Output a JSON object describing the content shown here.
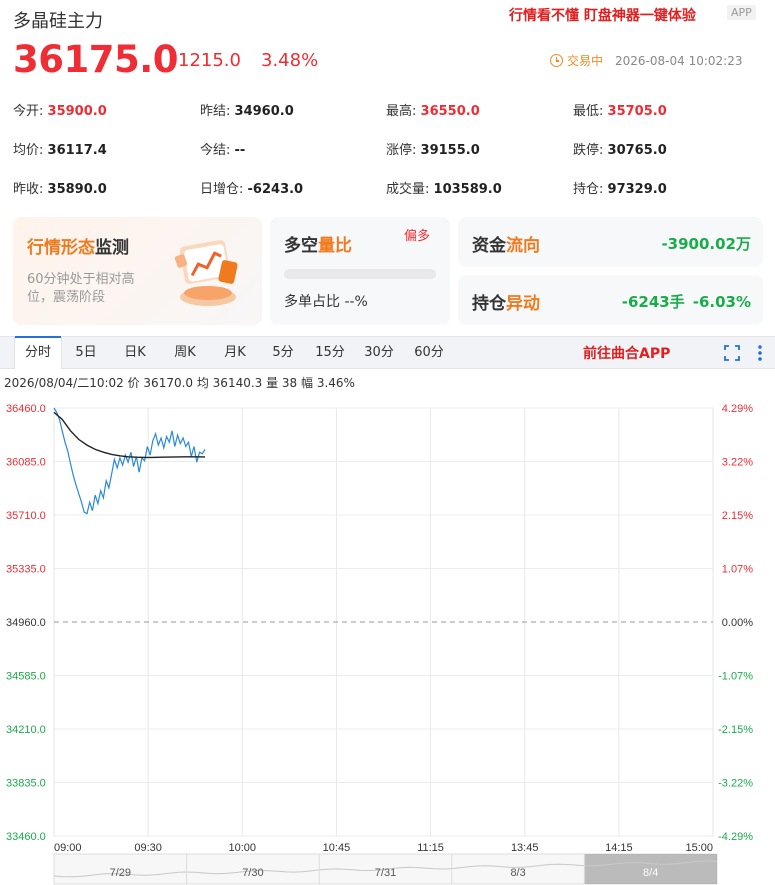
{
  "header": {
    "title": "多晶硅主力",
    "promo": "行情看不懂 盯盘神器一键体验",
    "app_badge": "APP",
    "price": "36175.0",
    "change": "1215.0",
    "change_pct": "3.48%",
    "status": "交易中",
    "datetime": "2026-08-04 10:02:23",
    "accent_up": "#ee2d34",
    "accent_down": "#1aab4b"
  },
  "stats": {
    "row1": [
      {
        "label": "今开:",
        "value": "35900.0",
        "color": "red"
      },
      {
        "label": "昨结:",
        "value": "34960.0",
        "color": "black"
      },
      {
        "label": "最高:",
        "value": "36550.0",
        "color": "red"
      },
      {
        "label": "最低:",
        "value": "35705.0",
        "color": "red"
      }
    ],
    "row2": [
      {
        "label": "均价:",
        "value": "36117.4",
        "color": "black"
      },
      {
        "label": "今结:",
        "value": "--",
        "color": "black"
      },
      {
        "label": "涨停:",
        "value": "39155.0",
        "color": "black"
      },
      {
        "label": "跌停:",
        "value": "30765.0",
        "color": "black"
      }
    ],
    "row3": [
      {
        "label": "昨收:",
        "value": "35890.0",
        "color": "black"
      },
      {
        "label": "日增仓:",
        "value": "-6243.0",
        "color": "black"
      },
      {
        "label": "成交量:",
        "value": "103589.0",
        "color": "black"
      },
      {
        "label": "持仓:",
        "value": "97329.0",
        "color": "black"
      }
    ]
  },
  "cards": {
    "pattern": {
      "title_a": "行情形态",
      "title_b": "监测",
      "desc": "60分钟处于相对高位，震荡阶段",
      "icon": "chart-illustration-icon"
    },
    "long_short": {
      "title_a": "多空",
      "title_b": "量比",
      "tag": "偏多",
      "ratio_label": "多单占比 --%"
    },
    "capital": {
      "title_a": "资金",
      "title_b": "流向",
      "value": "-3900.02万"
    },
    "position": {
      "title_a": "持仓",
      "title_b": "异动",
      "value": "-6243手",
      "pct": "-6.03%"
    }
  },
  "tabs": {
    "items": [
      "分时",
      "5日",
      "日K",
      "周K",
      "月K",
      "5分",
      "15分",
      "30分",
      "60分"
    ],
    "active": "分时",
    "cta": "前往曲合APP"
  },
  "info_line": "2026/08/04/二10:02  价 36170.0  均 36140.3  量 38  幅 3.46%",
  "chart_data": {
    "type": "line",
    "y_left_ticks": [
      "36460.0",
      "36085.0",
      "35710.0",
      "35335.0",
      "34960.0",
      "34585.0",
      "34210.0",
      "33835.0",
      "33460.0"
    ],
    "y_right_ticks": [
      "4.29%",
      "3.22%",
      "2.15%",
      "1.07%",
      "0.00%",
      "-1.07%",
      "-2.15%",
      "-3.22%",
      "-4.29%"
    ],
    "x_ticks": [
      "09:00",
      "09:30",
      "10:00",
      "10:45",
      "11:15",
      "13:45",
      "14:15",
      "15:00"
    ],
    "ylim": [
      33460.0,
      36460.0
    ],
    "base": 34960.0,
    "navigator_labels": [
      "7/29",
      "7/30",
      "7/31",
      "8/3",
      "8/4"
    ],
    "series": [
      {
        "values": [
          [
            0,
            36460
          ],
          [
            1,
            36430
          ],
          [
            2,
            36380
          ],
          [
            3,
            36300
          ],
          [
            4,
            36220
          ],
          [
            5,
            36160
          ],
          [
            6,
            36070
          ],
          [
            7,
            35990
          ],
          [
            8,
            35920
          ],
          [
            9,
            35860
          ],
          [
            10,
            35800
          ],
          [
            11,
            35730
          ],
          [
            12,
            35720
          ],
          [
            13,
            35800
          ],
          [
            14,
            35740
          ],
          [
            15,
            35850
          ],
          [
            16,
            35790
          ],
          [
            17,
            35880
          ],
          [
            18,
            35830
          ],
          [
            19,
            35950
          ],
          [
            20,
            35900
          ],
          [
            21,
            36000
          ],
          [
            22,
            36100
          ],
          [
            23,
            36040
          ],
          [
            24,
            36110
          ],
          [
            25,
            36060
          ],
          [
            26,
            36130
          ],
          [
            27,
            36080
          ],
          [
            28,
            36150
          ],
          [
            29,
            36050
          ],
          [
            30,
            36120
          ],
          [
            31,
            36010
          ],
          [
            32,
            36110
          ],
          [
            33,
            36090
          ],
          [
            34,
            36190
          ],
          [
            35,
            36130
          ],
          [
            36,
            36230
          ],
          [
            37,
            36280
          ],
          [
            38,
            36200
          ],
          [
            39,
            36250
          ],
          [
            40,
            36180
          ],
          [
            41,
            36260
          ],
          [
            42,
            36220
          ],
          [
            43,
            36300
          ],
          [
            44,
            36190
          ],
          [
            45,
            36270
          ],
          [
            46,
            36210
          ],
          [
            47,
            36250
          ],
          [
            48,
            36190
          ],
          [
            49,
            36220
          ],
          [
            50,
            36120
          ],
          [
            51,
            36190
          ],
          [
            52,
            36080
          ],
          [
            53,
            36150
          ],
          [
            54,
            36140
          ],
          [
            55,
            36170
          ]
        ],
        "color": "#2a8ad8"
      },
      {
        "values": [
          [
            0,
            36430
          ],
          [
            3,
            36380
          ],
          [
            6,
            36300
          ],
          [
            9,
            36240
          ],
          [
            12,
            36200
          ],
          [
            15,
            36170
          ],
          [
            18,
            36150
          ],
          [
            21,
            36135
          ],
          [
            24,
            36125
          ],
          [
            27,
            36118
          ],
          [
            30,
            36115
          ],
          [
            33,
            36114
          ],
          [
            36,
            36114
          ],
          [
            39,
            36115
          ],
          [
            42,
            36116
          ],
          [
            45,
            36117
          ],
          [
            48,
            36118
          ],
          [
            51,
            36118
          ],
          [
            55,
            36117
          ]
        ],
        "color": "#222222"
      }
    ]
  }
}
